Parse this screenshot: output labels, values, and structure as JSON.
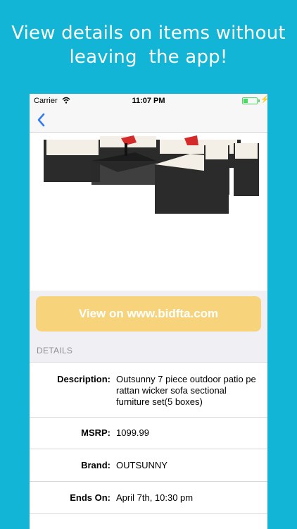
{
  "promo": {
    "line1": "View details on items without",
    "line2": "leaving  the app!"
  },
  "status_bar": {
    "carrier": "Carrier",
    "time": "11:07 PM",
    "battery_icon": "battery-charging-icon",
    "wifi_icon": "wifi-icon"
  },
  "nav": {
    "back_icon": "chevron-left-icon"
  },
  "product": {
    "image_alt": "patio furniture set"
  },
  "cta": {
    "label": "View on www.bidfta.com"
  },
  "details": {
    "header": "DETAILS",
    "rows": [
      {
        "label": "Description:",
        "value": "Outsunny 7 piece outdoor patio pe rattan wicker sofa sectional furniture set(5 boxes)"
      },
      {
        "label": "MSRP:",
        "value": "1099.99"
      },
      {
        "label": "Brand:",
        "value": "OUTSUNNY"
      },
      {
        "label": "Ends On:",
        "value": "April 7th, 10:30 pm"
      }
    ]
  },
  "colors": {
    "background": "#12b5d6",
    "cta": "#f7d47c",
    "accent": "#2f7cf6",
    "battery": "#4cd964"
  }
}
